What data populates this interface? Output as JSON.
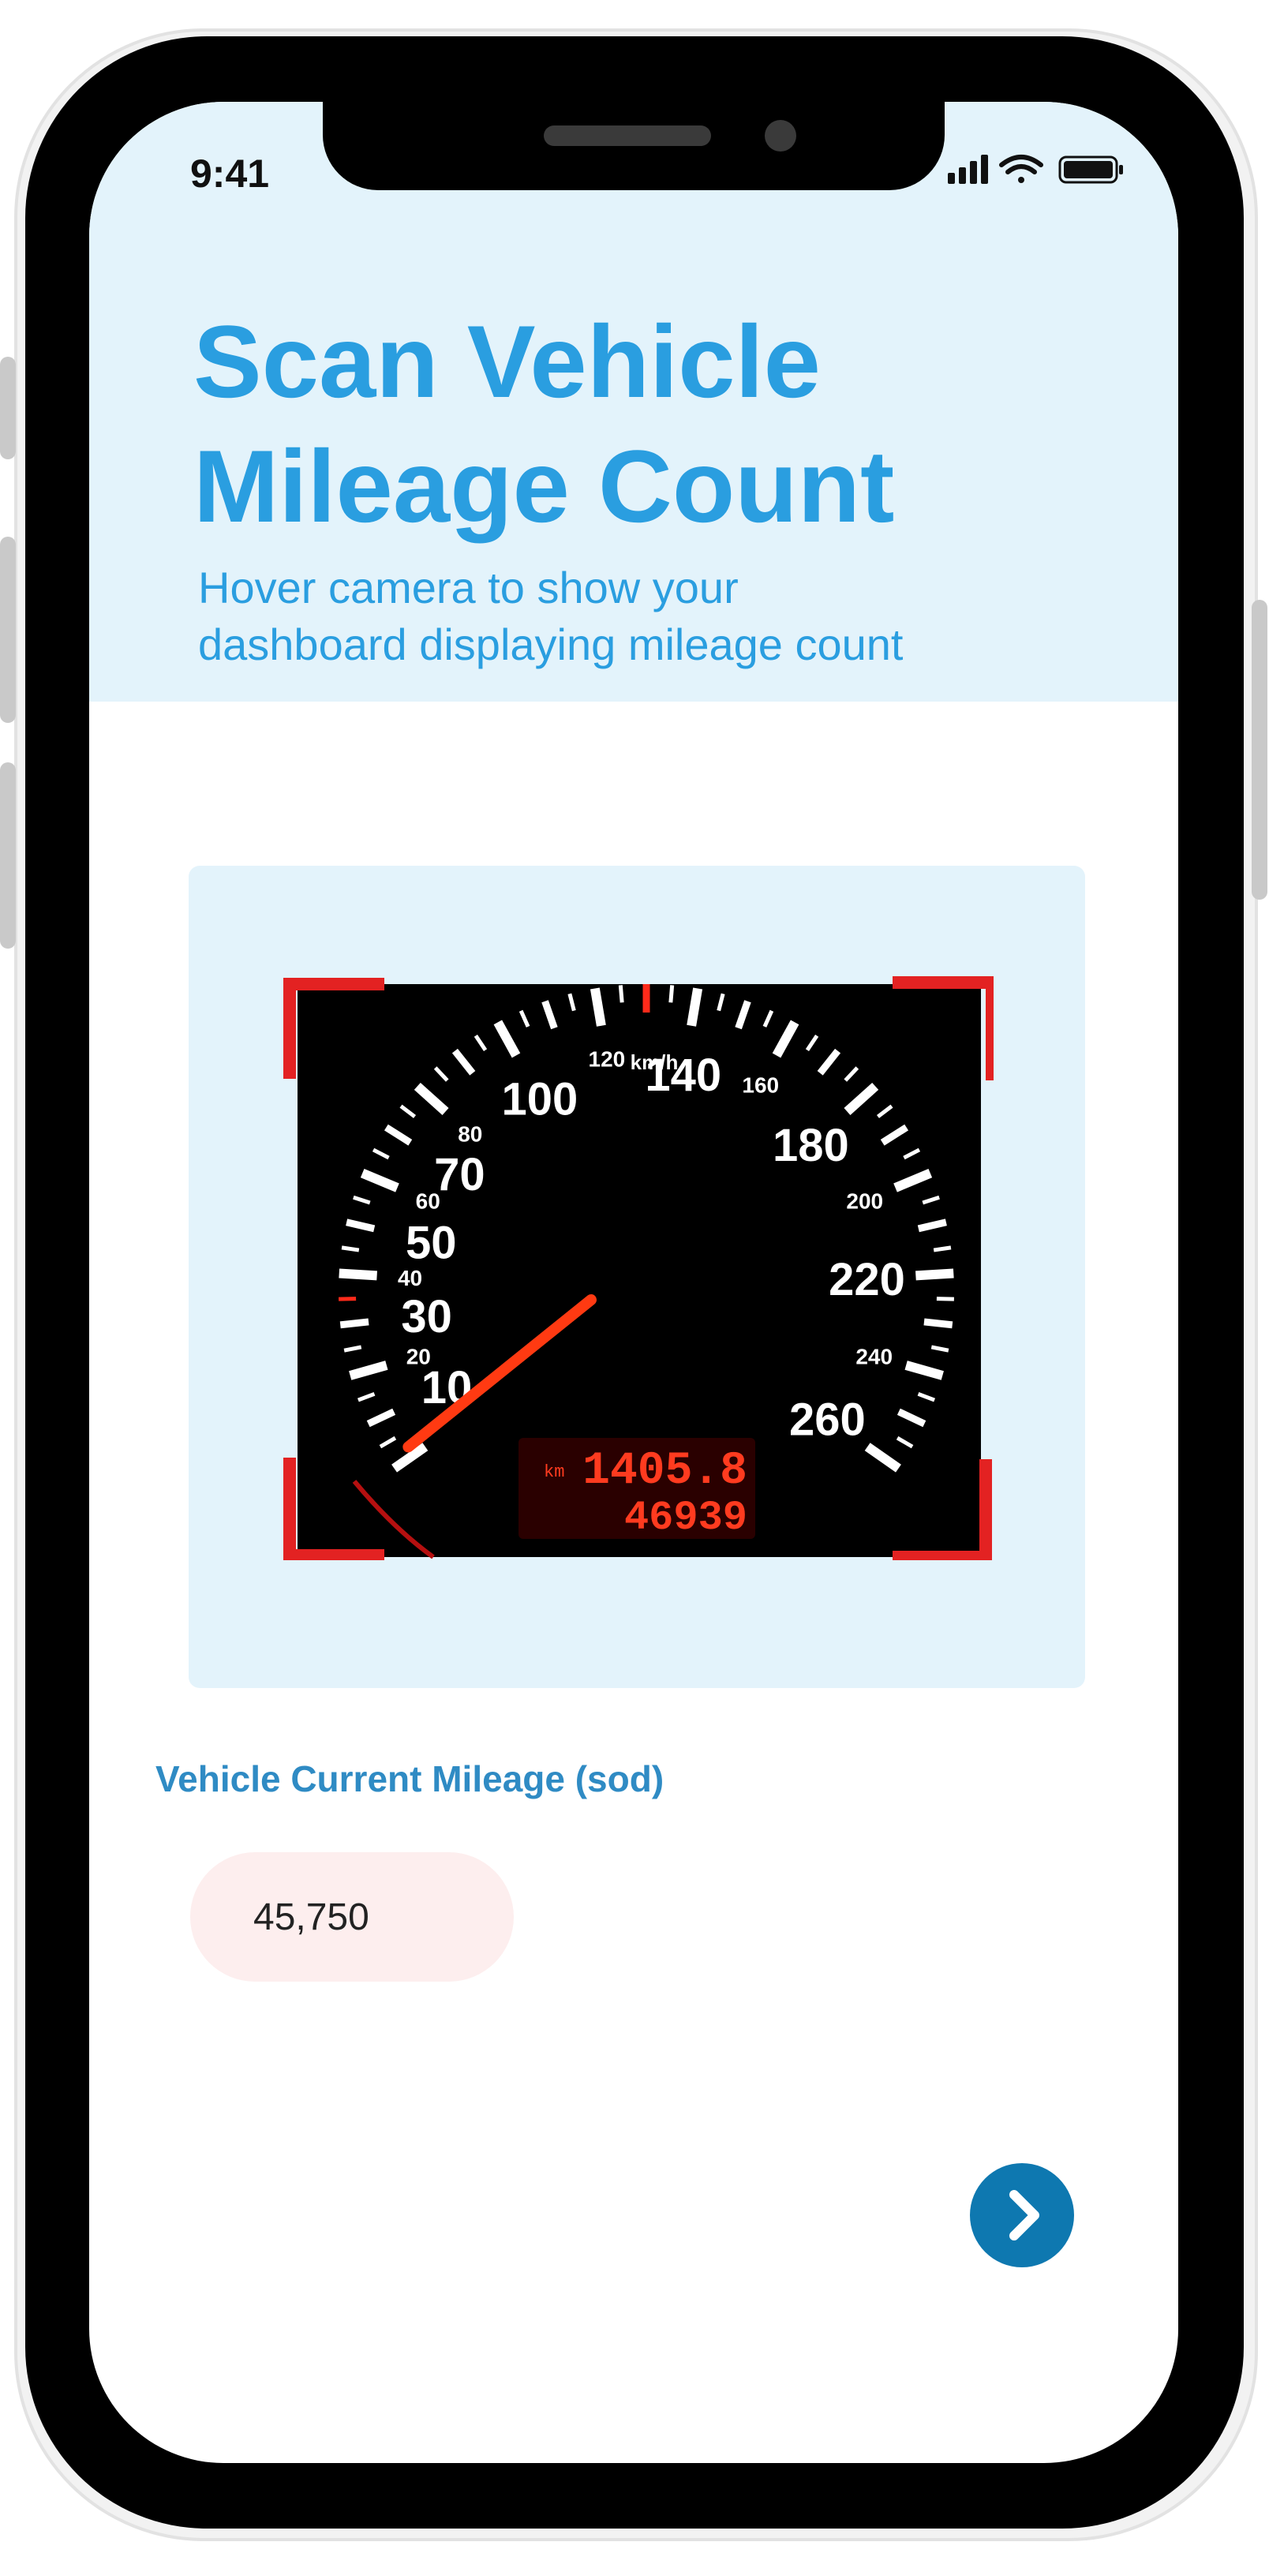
{
  "status_bar": {
    "time": "9:41"
  },
  "header": {
    "title": "Scan Vehicle\nMileage Count",
    "subtitle": "Hover camera to show your\ndashboard displaying mileage count"
  },
  "scanner": {
    "speed_unit": "km/h",
    "major_ticks": [
      "10",
      "30",
      "50",
      "70",
      "100",
      "140",
      "180",
      "220",
      "260"
    ],
    "minor_ticks": [
      "20",
      "40",
      "60",
      "80",
      "120",
      "160",
      "200",
      "240"
    ],
    "odometer": {
      "unit": "km",
      "trip": "1405.8",
      "total": "46939"
    }
  },
  "mileage_field": {
    "label": "Vehicle Current Mileage (sod)",
    "value": "45,750"
  },
  "icons": {
    "signal": "signal-icon",
    "wifi": "wifi-icon",
    "battery": "battery-icon",
    "next": "chevron-right-icon"
  },
  "colors": {
    "accent": "#2a9ee0",
    "header_bg": "#e3f3fb",
    "button": "#0e78b0",
    "scan_corner": "#e32222",
    "input_bg": "#fdeeee"
  }
}
